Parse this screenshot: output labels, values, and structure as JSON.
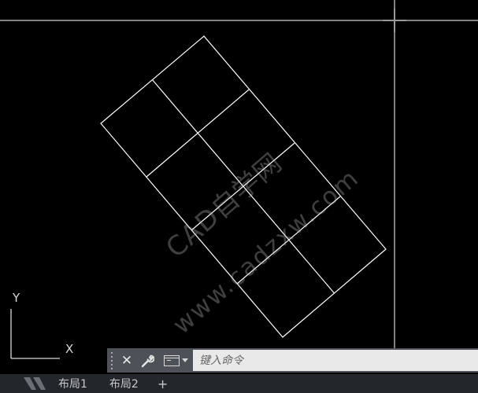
{
  "watermark": {
    "line1": "CAD自学网",
    "line2": "www.cadzxw.com"
  },
  "ucs": {
    "y_label": "Y",
    "x_label": "X"
  },
  "command_line": {
    "close_icon": "close-icon",
    "customize_icon": "wrench-icon",
    "recent_commands_icon": "command-prompt-icon",
    "input_placeholder": "键入命令",
    "input_value": ""
  },
  "layout_tabs": {
    "tabs": [
      {
        "label": "布局1"
      },
      {
        "label": "布局2"
      }
    ],
    "add_label": "+"
  },
  "colors": {
    "background": "#000000",
    "geometry": "#ffffff",
    "command_bar": "#4e5157",
    "tab_bar": "#23262b"
  }
}
